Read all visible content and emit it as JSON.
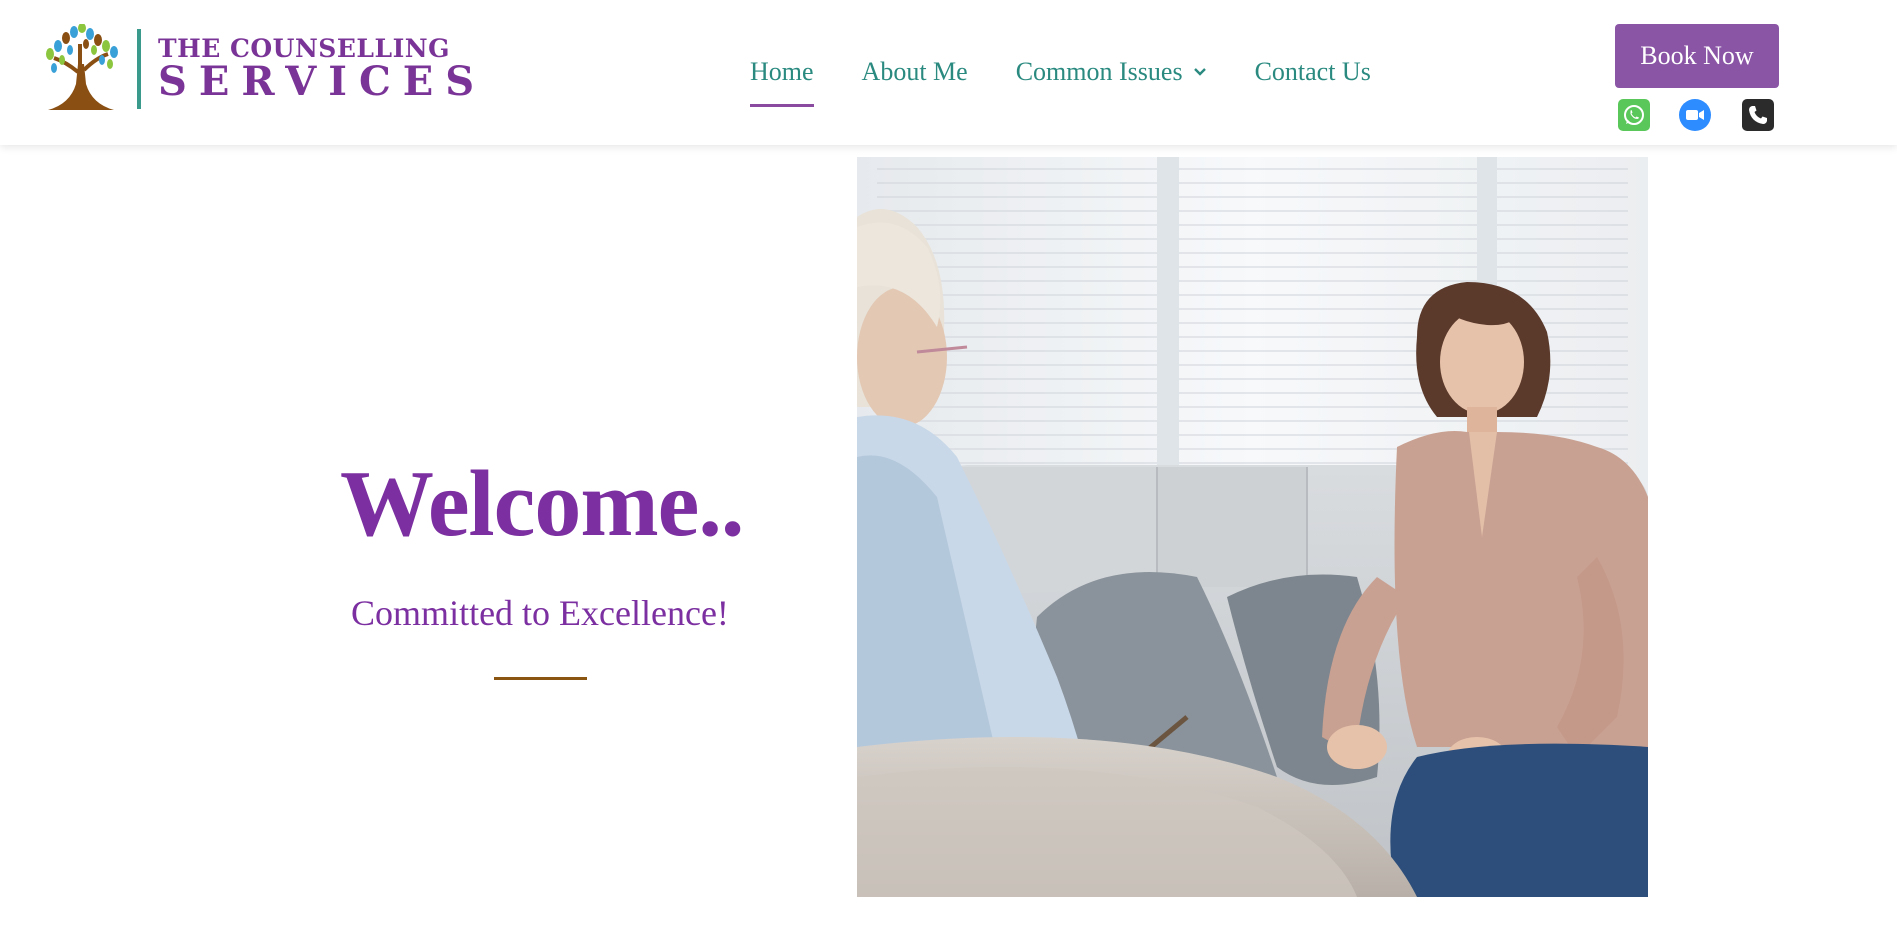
{
  "header": {
    "logo": {
      "line1": "THE COUNSELLING",
      "line2": "SERVICES",
      "brand_color": "#7a3497",
      "divider_color": "#3a9a8c",
      "icon": "tree-logo-icon"
    },
    "nav": {
      "items": [
        {
          "label": "Home",
          "active": true
        },
        {
          "label": "About Me",
          "active": false
        },
        {
          "label": "Common Issues",
          "active": false,
          "has_dropdown": true
        },
        {
          "label": "Contact Us",
          "active": false
        }
      ],
      "color": "#2a8a80",
      "active_underline_color": "#8a4aa0"
    },
    "book_button": {
      "label": "Book Now",
      "bg_color": "#8a55a5"
    },
    "contact_icons": [
      {
        "icon": "whatsapp-icon",
        "color": "#5ac75a"
      },
      {
        "icon": "zoom-video-icon",
        "color": "#2d8cff"
      },
      {
        "icon": "phone-icon",
        "color": "#2b2b2b"
      }
    ]
  },
  "hero": {
    "heading": "Welcome..",
    "tagline": "Committed to Excellence!",
    "text_color": "#7b2fa0",
    "divider_color": "#8a5510",
    "photo": "counselling-session-photo"
  }
}
